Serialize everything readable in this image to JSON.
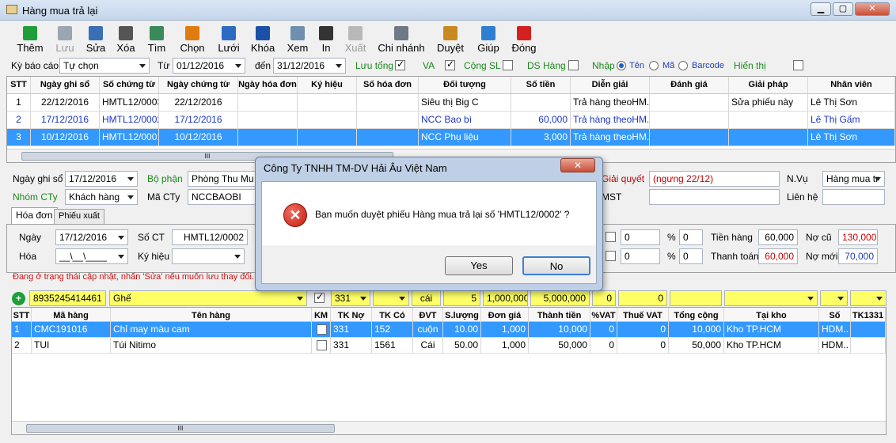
{
  "window": {
    "title": "Hàng mua trả lại"
  },
  "toolbar": [
    {
      "label": "Thêm",
      "icon": "plus-icon",
      "color": "#1f9e3a",
      "enabled": true
    },
    {
      "label": "Lưu",
      "icon": "save-icon",
      "color": "#9aa6b2",
      "enabled": false
    },
    {
      "label": "Sửa",
      "icon": "pencil-icon",
      "color": "#3a6fb5",
      "enabled": true
    },
    {
      "label": "Xóa",
      "icon": "scissors-icon",
      "color": "#555555",
      "enabled": true
    },
    {
      "label": "Tìm",
      "icon": "find-icon",
      "color": "#3a8a5a",
      "enabled": true
    },
    {
      "label": "Chọn",
      "icon": "gear-icon",
      "color": "#e07b10",
      "enabled": true
    },
    {
      "label": "Lưới",
      "icon": "grid-icon",
      "color": "#2d6bc2",
      "enabled": true
    },
    {
      "label": "Khóa",
      "icon": "lock-icon",
      "color": "#1b50a8",
      "enabled": true
    },
    {
      "label": "Xem",
      "icon": "preview-icon",
      "color": "#6f8faf",
      "enabled": true
    },
    {
      "label": "In",
      "icon": "printer-icon",
      "color": "#333333",
      "enabled": true
    },
    {
      "label": "Xuất",
      "icon": "export-icon",
      "color": "#b8b8b8",
      "enabled": false
    },
    {
      "label": "Chi nhánh",
      "icon": "building-icon",
      "color": "#6d7a86",
      "enabled": true
    },
    {
      "label": "Duyệt",
      "icon": "approve-icon",
      "color": "#c88a20",
      "enabled": true
    },
    {
      "label": "Giúp",
      "icon": "help-icon",
      "color": "#2f7fd0",
      "enabled": true
    },
    {
      "label": "Đóng",
      "icon": "power-icon",
      "color": "#d42020",
      "enabled": true
    }
  ],
  "filter": {
    "ky_bao_cao_label": "Kỳ báo cáo",
    "ky_bao_cao": "Tự chọn",
    "tu_label": "Từ",
    "tu": "01/12/2016",
    "den_label": "đến",
    "den": "31/12/2016",
    "luu_tong": "Lưu tổng",
    "va": "VA",
    "cong_sl": "Cộng SL",
    "ds_hang": "DS Hàng",
    "nhap": "Nhập",
    "ten": "Tên",
    "ma": "Mã",
    "barcode": "Barcode",
    "hien_thi": "Hiển thị"
  },
  "master_grid": {
    "headers": [
      "STT",
      "Ngày ghi sổ",
      "Số chứng từ",
      "Ngày chứng từ",
      "Ngày hóa đơn",
      "Ký hiệu",
      "Số hóa đơn",
      "Đối tượng",
      "Số tiền",
      "Diễn giải",
      "Đánh giá",
      "Giải pháp",
      "Nhân viên"
    ],
    "rows": [
      [
        "1",
        "22/12/2016",
        "HMTL12/0003",
        "22/12/2016",
        "",
        "",
        "",
        "Siêu thị Big C",
        "",
        "Trả hàng theoHM...",
        "",
        "Sửa phiếu này",
        "Lê Thị Sơn"
      ],
      [
        "2",
        "17/12/2016",
        "HMTL12/0002",
        "17/12/2016",
        "",
        "",
        "",
        "NCC Bao bì",
        "60,000",
        "Trả hàng theoHM...",
        "",
        "",
        "Lê Thị Gấm"
      ],
      [
        "3",
        "10/12/2016",
        "HMTL12/0001",
        "10/12/2016",
        "",
        "",
        "",
        "NCC Phụ liệu",
        "3,000",
        "Trả hàng theoHM...",
        "",
        "",
        "Lê Thị Sơn"
      ]
    ]
  },
  "form": {
    "ngay_ghi_so_label": "Ngày ghi sổ",
    "ngay_ghi_so": "17/12/2016",
    "bo_phan_label": "Bộ phận",
    "bo_phan": "Phòng Thu Mu",
    "nhom_cty_label": "Nhóm CTy",
    "nhom_cty": "Khách hàng",
    "ma_cty_label": "Mã CTy",
    "ma_cty": "NCCBAOBI",
    "giai_quyet_label": "Giải quyết",
    "giai_quyet": "(ngưng 22/12)",
    "nvu_label": "N.Vụ",
    "nvu": "Hàng mua tr",
    "mst_label": "MST",
    "lien_he_label": "Liên hệ",
    "tab_hoa_don": "Hóa đơn",
    "tab_phieu_xuat": "Phiếu xuất",
    "ngay_label": "Ngày",
    "ngay": "17/12/2016",
    "so_ct_label": "Số CT",
    "so_ct": "HMTL12/0002",
    "hoa_label": "Hóa",
    "hoa": "__\\__\\____",
    "ky_hieu_label": "Ký hiệu",
    "pct1": "0",
    "pct1b": "0",
    "pct2": "0",
    "pct2b": "0",
    "percent": "%",
    "tien_hang_label": "Tiền hàng",
    "tien_hang": "60,000",
    "thanh_toan_label": "Thanh toán",
    "thanh_toan": "60,000",
    "no_cu_label": "Nợ cũ",
    "no_cu": "130,000",
    "no_moi_label": "Nợ mới",
    "no_moi": "70,000",
    "status": "Đang ở trạng thái cập nhật, nhấn 'Sửa' nếu muốn lưu thay đổi."
  },
  "entry": {
    "barcode": "8935245414461",
    "ten": "Ghế",
    "tk": "331",
    "dvt": "cái",
    "sl": "5",
    "dongia": "1,000,000",
    "thanhtien": "5,000,000",
    "vat": "0",
    "thue": "0"
  },
  "detail_grid": {
    "headers": [
      "STT",
      "Mã hàng",
      "Tên hàng",
      "KM",
      "TK Nợ",
      "TK Có",
      "ĐVT",
      "S.lượng",
      "Đơn giá",
      "Thành tiền",
      "%VAT",
      "Thuế VAT",
      "Tổng cộng",
      "Tại kho",
      "Số",
      "TK1331"
    ],
    "rows": [
      [
        "1",
        "CMC191016",
        "Chỉ may màu cam",
        "",
        "331",
        "152",
        "cuộn",
        "10.00",
        "1,000",
        "10,000",
        "0",
        "0",
        "10,000",
        "Kho TP.HCM",
        "HDM..",
        ""
      ],
      [
        "2",
        "TUI",
        "Túi Nitimo",
        "",
        "331",
        "1561",
        "Cái",
        "50.00",
        "1,000",
        "50,000",
        "0",
        "0",
        "50,000",
        "Kho TP.HCM",
        "HDM..",
        ""
      ]
    ]
  },
  "dialog": {
    "title": "Công Ty TNHH TM-DV Hải Âu Việt Nam",
    "message": "Bạn muốn duyệt phiếu Hàng mua trả lại số 'HMTL12/0002' ?",
    "yes": "Yes",
    "no": "No",
    "icon": "error-icon"
  }
}
